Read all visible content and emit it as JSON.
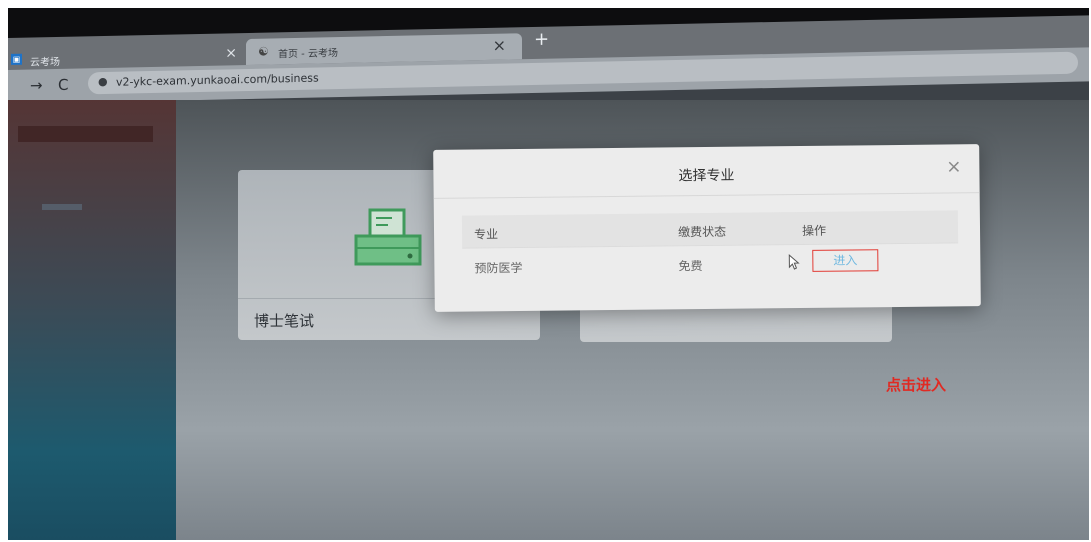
{
  "browser": {
    "tabs": [
      {
        "label": "云考场",
        "close": "×"
      },
      {
        "label": "首页 - 云考场",
        "close": "×"
      }
    ],
    "new_tab": "+",
    "nav": {
      "back": "→",
      "reload": "C"
    },
    "url": "v2-ykc-exam.yunkaoai.com/business"
  },
  "cards": [
    {
      "label": "博士笔试"
    },
    {
      "label": ""
    }
  ],
  "modal": {
    "title": "选择专业",
    "close": "×",
    "columns": [
      "专业",
      "缴费状态",
      "操作"
    ],
    "rows": [
      {
        "major": "预防医学",
        "status": "免费",
        "action": "进入"
      }
    ]
  },
  "annotation": {
    "text": "点击进入",
    "color": "#e02a23"
  },
  "colors": {
    "accent_border": "#e23b34",
    "link_blue": "#6fb8e0",
    "icon_green": "#3f9a5b"
  }
}
